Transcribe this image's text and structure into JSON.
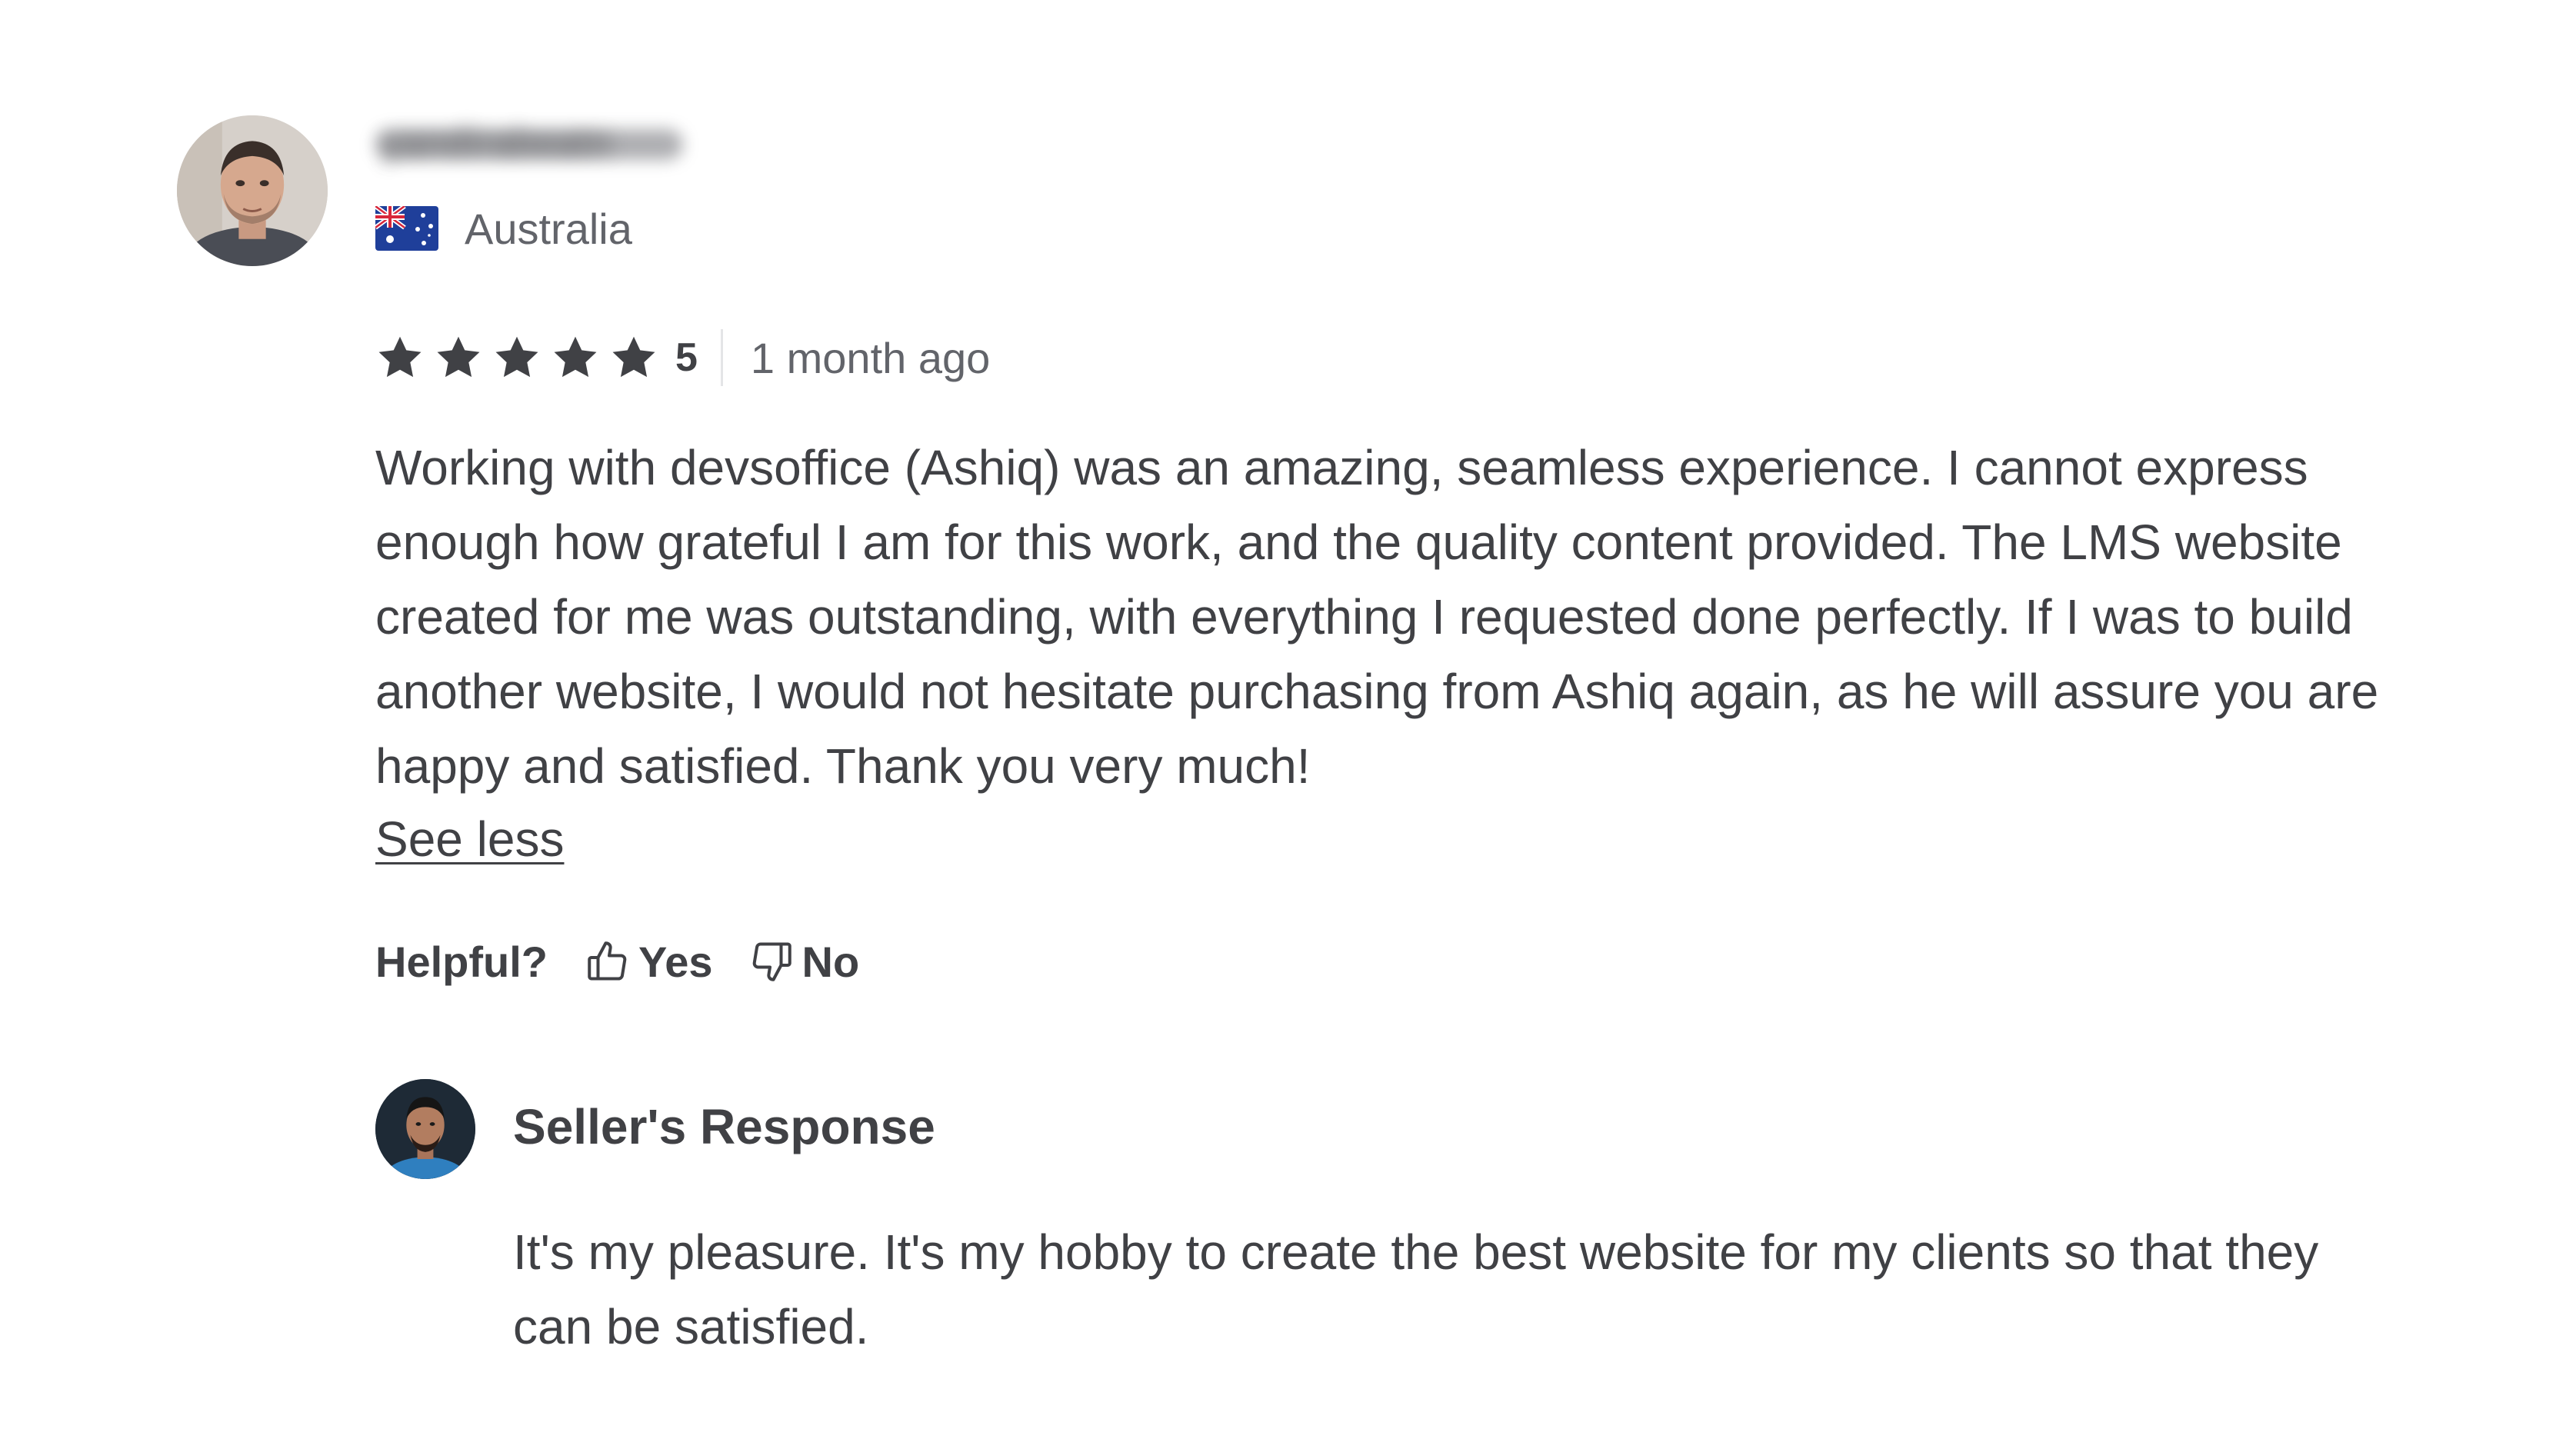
{
  "review": {
    "reviewer": {
      "username": "yandirabeatn",
      "country": "Australia",
      "flag_icon": "australia-flag-icon"
    },
    "rating": {
      "stars": 5,
      "value_label": "5",
      "time_ago": "1 month ago"
    },
    "body": "Working with devsoffice (Ashiq) was an amazing, seamless experience. I cannot express enough how grateful I am for this work, and the quality content provided. The LMS website created for me was outstanding, with everything I requested done perfectly. If I was to build another website, I would not hesitate purchasing from Ashiq again, as he will assure you are happy and satisfied. Thank you very much!",
    "see_less_label": "See less",
    "helpful": {
      "label": "Helpful?",
      "yes_label": "Yes",
      "no_label": "No"
    }
  },
  "seller_response": {
    "title": "Seller's Response",
    "body": "It's my pleasure. It's my hobby to create the best website for my clients so that they can be satisfied."
  },
  "colors": {
    "text_primary": "#404145",
    "text_secondary": "#62646a",
    "star": "#404145",
    "divider": "#e4e5e7"
  }
}
